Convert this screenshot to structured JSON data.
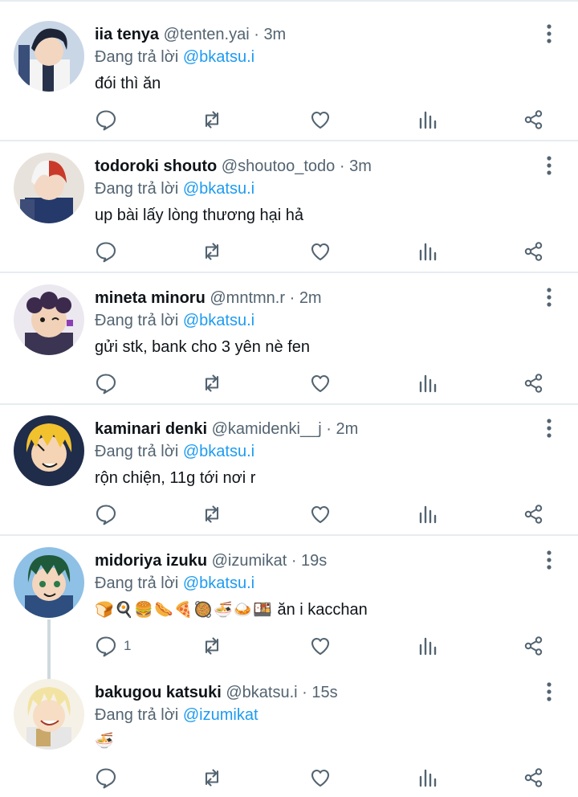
{
  "colors": {
    "text": "#0f1419",
    "secondary": "#536471",
    "mention": "#1d9bf0",
    "divider": "#e6ecf0",
    "icon": "#536471"
  },
  "icons": {
    "reply": "reply-icon",
    "retweet": "retweet-icon",
    "like": "heart-icon",
    "stats": "stats-icon",
    "share": "share-icon",
    "more": "more-vertical-icon"
  },
  "tweets": [
    {
      "name": "iia tenya",
      "handle": "@tenten.yai",
      "dot": "·",
      "time": "3m",
      "reply_prefix": "Đang trả lời",
      "reply_to": "@bkatsu.i",
      "text": "đói thì ăn"
    },
    {
      "name": "todoroki shouto",
      "handle": "@shoutoo_todo",
      "dot": "·",
      "time": "3m",
      "reply_prefix": "Đang trả lời",
      "reply_to": "@bkatsu.i",
      "text": "up bài lấy lòng thương hại hả"
    },
    {
      "name": "mineta minoru",
      "handle": "@mntmn.r",
      "dot": "·",
      "time": "2m",
      "reply_prefix": "Đang trả lời",
      "reply_to": "@bkatsu.i",
      "text": "gửi stk, bank cho 3 yên nè fen"
    },
    {
      "name": "kaminari denki",
      "handle": "@kamidenki__j",
      "dot": "·",
      "time": "2m",
      "reply_prefix": "Đang trả lời",
      "reply_to": "@bkatsu.i",
      "text": "rộn chiện, 11g tới nơi r"
    },
    {
      "name": "midoriya izuku",
      "handle": "@izumikat",
      "dot": "·",
      "time": "19s",
      "reply_prefix": "Đang trả lời",
      "reply_to": "@bkatsu.i",
      "emojis": "🍞🍳🍔🌭🍕🥘🍜🍛🍱",
      "text": " ăn i kacchan",
      "reply_count": "1"
    },
    {
      "name": "bakugou katsuki",
      "handle": "@bkatsu.i",
      "dot": "·",
      "time": "15s",
      "reply_prefix": "Đang trả lời",
      "reply_to": "@izumikat",
      "emojis": "🍜"
    }
  ]
}
